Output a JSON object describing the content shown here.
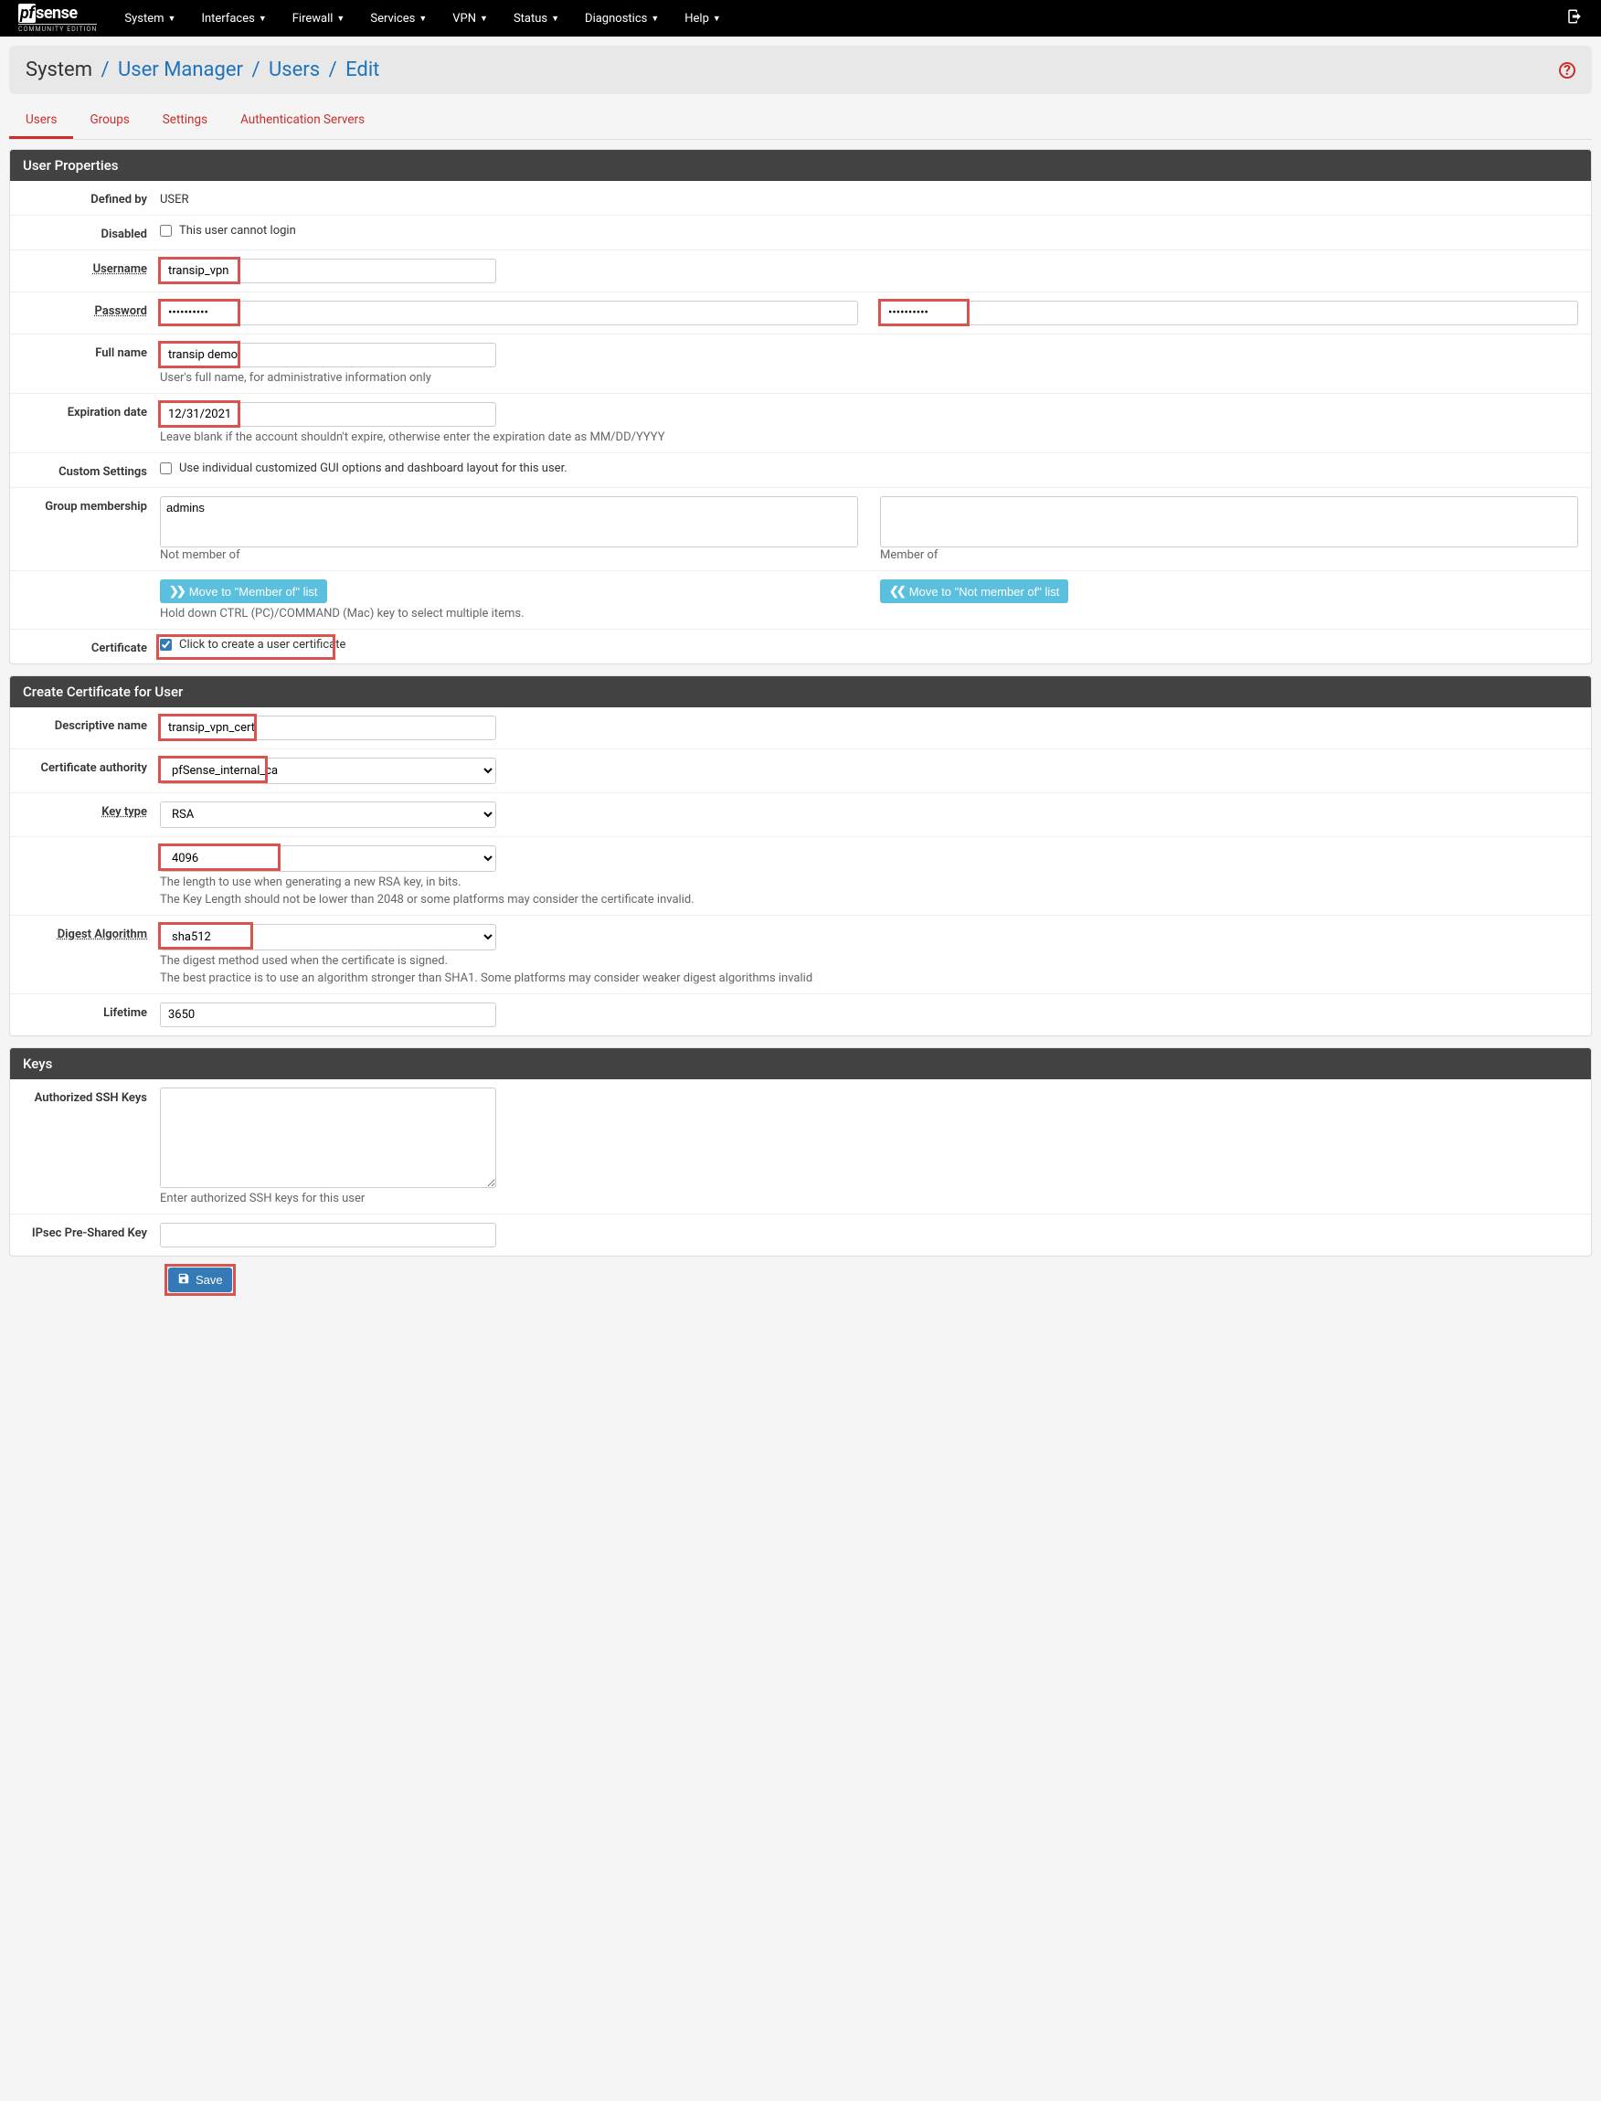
{
  "brand": {
    "pf": "pf",
    "sense": "sense",
    "tagline": "COMMUNITY EDITION"
  },
  "nav": [
    "System",
    "Interfaces",
    "Firewall",
    "Services",
    "VPN",
    "Status",
    "Diagnostics",
    "Help"
  ],
  "breadcrumb": {
    "l0": "System",
    "l1": "User Manager",
    "l2": "Users",
    "l3": "Edit"
  },
  "tabs": [
    "Users",
    "Groups",
    "Settings",
    "Authentication Servers"
  ],
  "panels": {
    "user_props": "User Properties",
    "cert": "Create Certificate for User",
    "keys": "Keys"
  },
  "labels": {
    "defined_by": "Defined by",
    "disabled": "Disabled",
    "username": "Username",
    "password": "Password",
    "fullname": "Full name",
    "expiration": "Expiration date",
    "custom": "Custom Settings",
    "groups": "Group membership",
    "certificate": "Certificate",
    "desc_name": "Descriptive name",
    "ca": "Certificate authority",
    "key_type": "Key type",
    "digest": "Digest Algorithm",
    "lifetime": "Lifetime",
    "ssh": "Authorized SSH Keys",
    "ipsec": "IPsec Pre-Shared Key"
  },
  "values": {
    "defined_by": "USER",
    "disabled_text": "This user cannot login",
    "username": "transip_vpn",
    "password": "••••••••••",
    "password_confirm": "••••••••••",
    "fullname": "transip demo",
    "fullname_help": "User's full name, for administrative information only",
    "expiration": "12/31/2021",
    "expiration_help": "Leave blank if the account shouldn't expire, otherwise enter the expiration date as MM/DD/YYYY",
    "custom_text": "Use individual customized GUI options and dashboard layout for this user.",
    "not_member_list": "admins",
    "not_member_label": "Not member of",
    "member_label": "Member of",
    "move_to_member": "Move to \"Member of\" list",
    "move_to_not_member": "Move to \"Not member of\" list",
    "groups_help": "Hold down CTRL (PC)/COMMAND (Mac) key to select multiple items.",
    "cert_checkbox": "Click to create a user certificate",
    "desc_name": "transip_vpn_cert",
    "ca": "pfSense_internal_ca",
    "key_type": "RSA",
    "key_len": "4096",
    "key_len_help1": "The length to use when generating a new RSA key, in bits.",
    "key_len_help2": "The Key Length should not be lower than 2048 or some platforms may consider the certificate invalid.",
    "digest": "sha512",
    "digest_help1": "The digest method used when the certificate is signed.",
    "digest_help2": "The best practice is to use an algorithm stronger than SHA1. Some platforms may consider weaker digest algorithms invalid",
    "lifetime": "3650",
    "ssh_help": "Enter authorized SSH keys for this user",
    "save_btn": "Save"
  }
}
